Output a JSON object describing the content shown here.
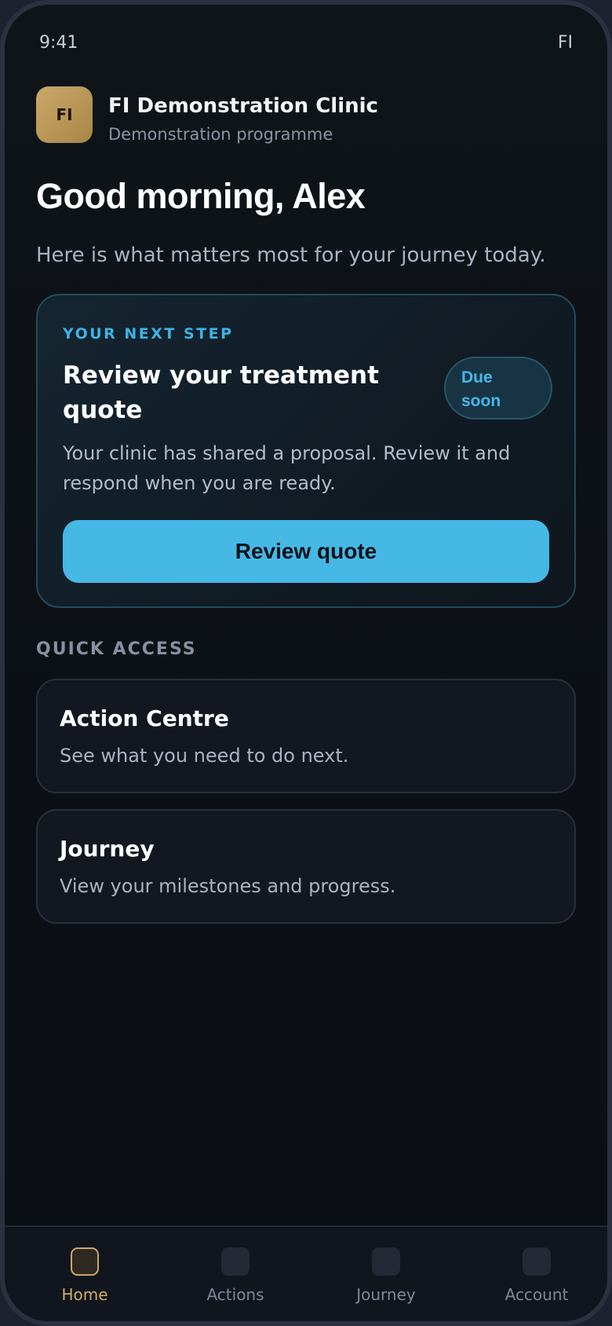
{
  "status_bar": {
    "time": "9:41",
    "right_label": "FI"
  },
  "clinic": {
    "logo_text": "FI",
    "name": "FI Demonstration Clinic",
    "subtitle": "Demonstration programme"
  },
  "greeting": "Good morning, Alex",
  "intro": "Here is what matters most for your journey today.",
  "next_step": {
    "eyebrow": "YOUR NEXT STEP",
    "title": "Review your treatment quote",
    "badge_line1": "Due",
    "badge_line2": "soon",
    "description": "Your clinic has shared a proposal. Review it and respond when you are ready.",
    "button_label": "Review quote"
  },
  "quick_access": {
    "header": "QUICK ACCESS",
    "cards": [
      {
        "title": "Action Centre",
        "description": "See what you need to do next."
      },
      {
        "title": "Journey",
        "description": "View your milestones and progress."
      }
    ]
  },
  "bottom_nav": {
    "items": [
      {
        "label": "Home",
        "icon": "home-icon",
        "active": true
      },
      {
        "label": "Actions",
        "icon": "actions-icon",
        "active": false
      },
      {
        "label": "Journey",
        "icon": "journey-icon",
        "active": false
      },
      {
        "label": "Account",
        "icon": "account-icon",
        "active": false
      }
    ]
  },
  "colors": {
    "accent_blue": "#45b8e6",
    "accent_gold": "#c9a86a",
    "background": "#0c1015"
  }
}
